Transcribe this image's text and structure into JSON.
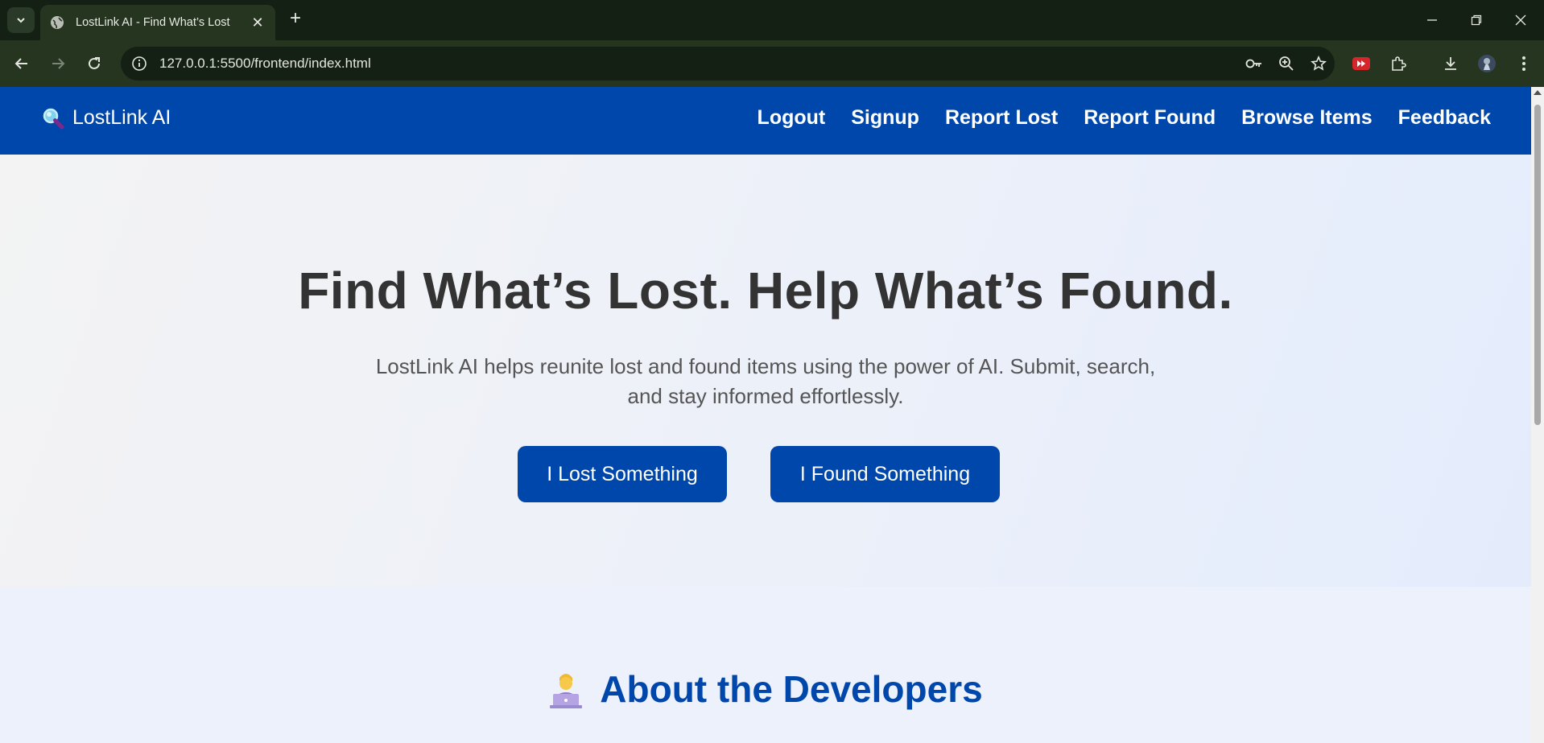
{
  "browser": {
    "tab_title": "LostLink AI - Find What’s Lost",
    "url": "127.0.0.1:5500/frontend/index.html"
  },
  "site": {
    "brand": "LostLink AI",
    "nav": [
      {
        "label": "Logout"
      },
      {
        "label": "Signup"
      },
      {
        "label": "Report Lost"
      },
      {
        "label": "Report Found"
      },
      {
        "label": "Browse Items"
      },
      {
        "label": "Feedback"
      }
    ],
    "hero": {
      "title": "Find What’s Lost. Help What’s Found.",
      "lead": "LostLink AI helps reunite lost and found items using the power of AI. Submit, search, and stay informed effortlessly.",
      "lost_button": "I Lost Something",
      "found_button": "I Found Something"
    },
    "about": {
      "title": "About the Developers"
    }
  },
  "colors": {
    "brand_blue": "#0047ab",
    "heading": "#333333",
    "chrome": "#26351f"
  }
}
